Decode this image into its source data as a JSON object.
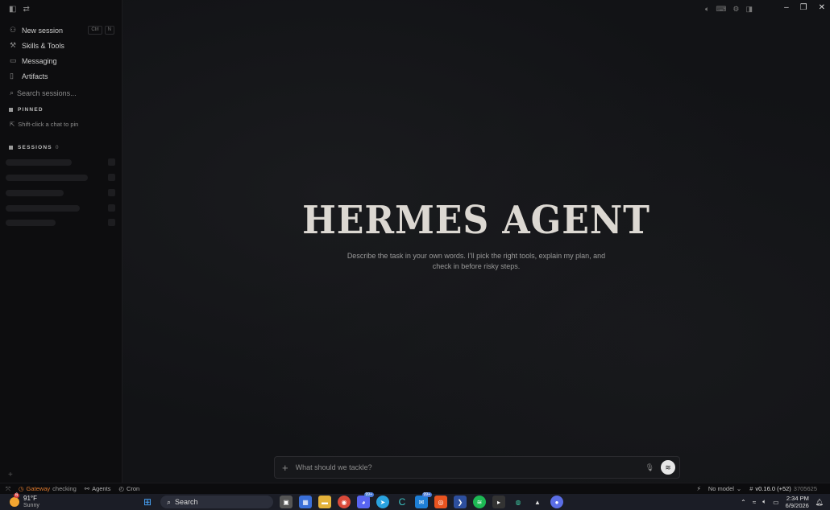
{
  "sidebar": {
    "nav": [
      {
        "label": "New session",
        "icon": "person-icon",
        "shortcut": [
          "Ctrl",
          "N"
        ]
      },
      {
        "label": "Skills & Tools",
        "icon": "tools-icon"
      },
      {
        "label": "Messaging",
        "icon": "chat-icon"
      },
      {
        "label": "Artifacts",
        "icon": "file-icon"
      }
    ],
    "search_placeholder": "Search sessions...",
    "pinned_header": "PINNED",
    "pin_hint": "Shift-click a chat to pin",
    "sessions_header": "SESSIONS",
    "sessions_count": "0"
  },
  "main": {
    "title": "HERMES AGENT",
    "subtitle": "Describe the task in your own words. I'll pick the right tools, explain my plan, and check in before risky steps."
  },
  "composer": {
    "placeholder": "What should we tackle?"
  },
  "statusbar": {
    "gateway_label": "Gateway",
    "gateway_status": "checking",
    "agents_label": "Agents",
    "cron_label": "Cron",
    "model_label": "No model",
    "version": "v0.16.0 (+52)",
    "commit": "3705625"
  },
  "taskbar": {
    "temperature": "91°F",
    "weather_desc": "Sunny",
    "weather_badge": "6",
    "search_label": "Search",
    "time": "2:34 PM",
    "date": "6/9/2026",
    "badge_discord": "99+",
    "badge_mail": "99+"
  }
}
